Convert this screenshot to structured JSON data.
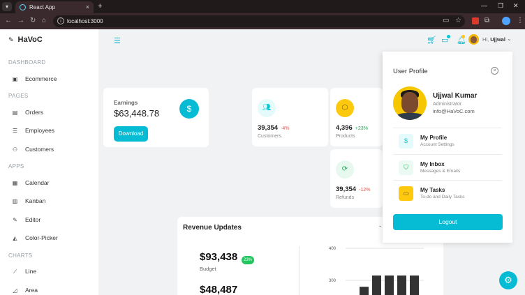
{
  "browser": {
    "tab_title": "React App",
    "url": "localhost:3000"
  },
  "sidebar": {
    "brand": "HaVoC",
    "sections": [
      {
        "title": "DASHBOARD",
        "items": [
          {
            "label": "Ecommerce",
            "icon": "shopping-bag-icon"
          }
        ]
      },
      {
        "title": "PAGES",
        "items": [
          {
            "label": "Orders",
            "icon": "cart-icon"
          },
          {
            "label": "Employees",
            "icon": "people-icon"
          },
          {
            "label": "Customers",
            "icon": "user-group-icon"
          }
        ]
      },
      {
        "title": "APPS",
        "items": [
          {
            "label": "Calendar",
            "icon": "calendar-icon"
          },
          {
            "label": "Kanban",
            "icon": "kanban-icon"
          },
          {
            "label": "Editor",
            "icon": "pencil-icon"
          },
          {
            "label": "Color-Picker",
            "icon": "color-drop-icon"
          }
        ]
      },
      {
        "title": "CHARTS",
        "items": [
          {
            "label": "Line",
            "icon": "line-chart-icon"
          },
          {
            "label": "Area",
            "icon": "area-chart-icon"
          }
        ]
      }
    ]
  },
  "header": {
    "greeting_prefix": "Hi,",
    "user_first": "Ujjwal",
    "accent": "#03C9D7"
  },
  "earnings": {
    "label": "Earnings",
    "value": "$63,448.78",
    "button": "Download"
  },
  "stats": [
    {
      "value": "39,354",
      "pct": "-4%",
      "label": "Customers",
      "pct_color": "#e34f4f",
      "icon": "customers-icon"
    },
    {
      "value": "4,396",
      "pct": "+23%",
      "label": "Products",
      "pct_color": "#22a655",
      "icon": "box-icon"
    },
    {
      "value": "39,354",
      "pct": "-12%",
      "label": "Refunds",
      "pct_color": "#e34f4f",
      "icon": "refresh-icon"
    }
  ],
  "revenue": {
    "title": "Revenue Updates",
    "budget_value": "$93,438",
    "budget_badge": "23%",
    "budget_label": "Budget",
    "expense_value": "$48,487"
  },
  "chart_data": {
    "type": "bar",
    "categories": [
      "",
      "",
      "",
      "",
      "",
      ""
    ],
    "values": [
      280,
      315,
      315,
      315,
      315,
      0
    ],
    "ylim": [
      250,
      400
    ],
    "yticks": [
      "400",
      "300"
    ],
    "xlabel": "",
    "ylabel": "",
    "title": ""
  },
  "profile": {
    "title": "User Profile",
    "name": "Ujjwal Kumar",
    "role": "Administrator",
    "email": "info@HaVoC.com",
    "items": [
      {
        "title": "My Profile",
        "desc": "Account Settings",
        "icon": "dollar-icon"
      },
      {
        "title": "My Inbox",
        "desc": "Messages & Emails",
        "icon": "shield-icon"
      },
      {
        "title": "My Tasks",
        "desc": "To-do and Daily Tasks",
        "icon": "card-icon"
      }
    ],
    "logout": "Logout"
  }
}
